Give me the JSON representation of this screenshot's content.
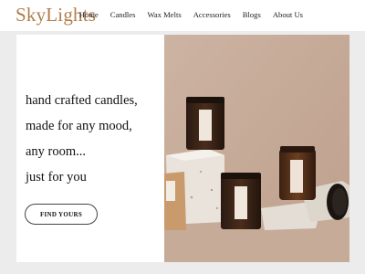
{
  "brand": {
    "name": "SkyLights",
    "color": "#b07d4a"
  },
  "nav": {
    "items": [
      {
        "label": "Home"
      },
      {
        "label": "Candles"
      },
      {
        "label": "Wax Melts"
      },
      {
        "label": "Accessories"
      },
      {
        "label": "Blogs"
      },
      {
        "label": "About Us"
      }
    ]
  },
  "hero": {
    "lines": [
      "hand crafted candles,",
      "made for any mood,",
      "any room...",
      "just for you"
    ],
    "cta_label": "FIND YOURS",
    "image": {
      "description": "amber glass candle jars on stone blocks",
      "background": "#c7ab98"
    }
  }
}
